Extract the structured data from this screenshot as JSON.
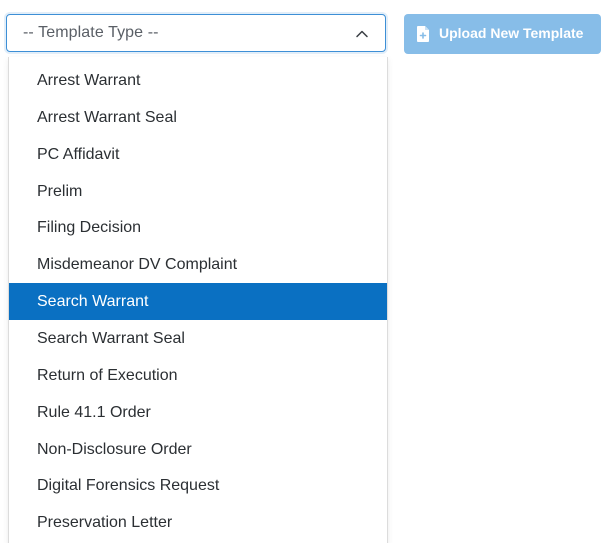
{
  "select": {
    "placeholder": "-- Template Type --",
    "chevron_icon": "chevron-up-icon"
  },
  "upload": {
    "label": "Upload New Template",
    "icon": "file-plus-icon"
  },
  "options": [
    {
      "label": "Arrest Warrant",
      "selected": false
    },
    {
      "label": "Arrest Warrant Seal",
      "selected": false
    },
    {
      "label": "PC Affidavit",
      "selected": false
    },
    {
      "label": "Prelim",
      "selected": false
    },
    {
      "label": "Filing Decision",
      "selected": false
    },
    {
      "label": "Misdemeanor DV Complaint",
      "selected": false
    },
    {
      "label": "Search Warrant",
      "selected": true
    },
    {
      "label": "Search Warrant Seal",
      "selected": false
    },
    {
      "label": "Return of Execution",
      "selected": false
    },
    {
      "label": "Rule 41.1 Order",
      "selected": false
    },
    {
      "label": "Non-Disclosure Order",
      "selected": false
    },
    {
      "label": "Digital Forensics Request",
      "selected": false
    },
    {
      "label": "Preservation Letter",
      "selected": false
    }
  ],
  "colors": {
    "highlight": "#0a70c2",
    "button": "#87bde8",
    "border_focus": "#3d8fd6"
  }
}
